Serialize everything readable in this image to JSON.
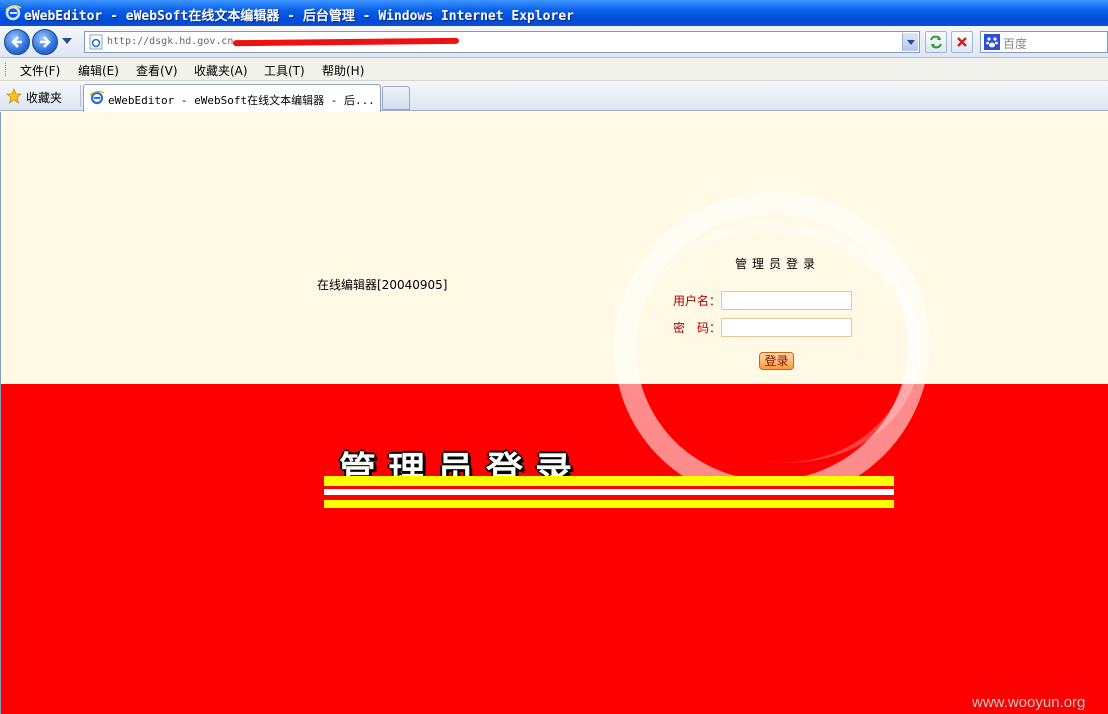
{
  "window": {
    "title": "eWebEditor - eWebSoft在线文本编辑器 - 后台管理 - Windows Internet Explorer",
    "icon": "ie-icon"
  },
  "address_bar": {
    "url": "http://dsgk.hd.gov.cn",
    "page_icon": "ie-page-icon"
  },
  "search": {
    "placeholder": "百度",
    "icon": "baidu-paw-icon"
  },
  "menu": {
    "items": [
      {
        "label": "文件(F)"
      },
      {
        "label": "编辑(E)"
      },
      {
        "label": "查看(V)"
      },
      {
        "label": "收藏夹(A)"
      },
      {
        "label": "工具(T)"
      },
      {
        "label": "帮助(H)"
      }
    ]
  },
  "favorites": {
    "label": "收藏夹",
    "icon": "star-icon"
  },
  "tabs": [
    {
      "label": "eWebEditor - eWebSoft在线文本编辑器 - 后...",
      "active": true
    }
  ],
  "page": {
    "editor_name": "在线编辑器[20040905]",
    "login": {
      "title": "管理员登录",
      "username_label": "用户名：",
      "password_label": "密　码：",
      "username_value": "",
      "password_value": "",
      "submit_label": "登录"
    },
    "banner_title": "管理员登录",
    "colors": {
      "top_background": "#fff9e6",
      "bottom_background": "#ff0000",
      "stripe": "#ffff00",
      "label": "#b00000"
    }
  },
  "watermark": "www.wooyun.org"
}
